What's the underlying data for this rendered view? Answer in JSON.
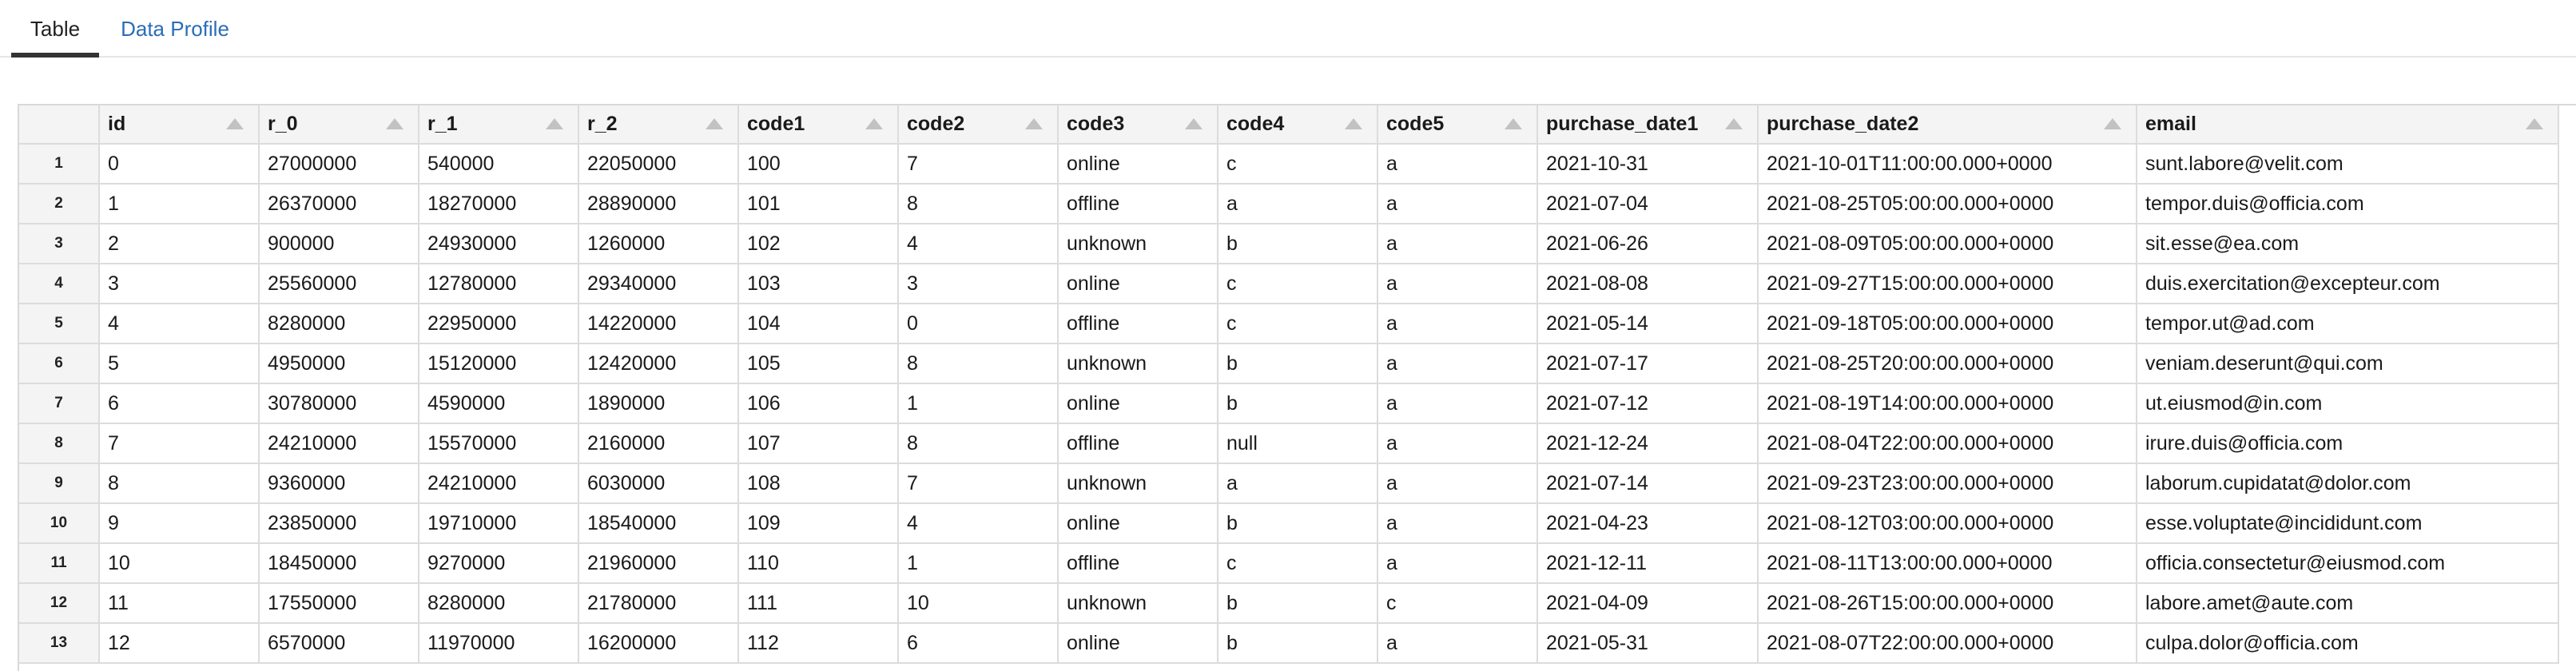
{
  "tabs": [
    {
      "label": "Table",
      "active": true
    },
    {
      "label": "Data Profile",
      "active": false
    }
  ],
  "table": {
    "columns": [
      "id",
      "r_0",
      "r_1",
      "r_2",
      "code1",
      "code2",
      "code3",
      "code4",
      "code5",
      "purchase_date1",
      "purchase_date2",
      "email"
    ],
    "rows": [
      {
        "n": "1",
        "cells": [
          "0",
          "27000000",
          "540000",
          "22050000",
          "100",
          "7",
          "online",
          "c",
          "a",
          "2021-10-31",
          "2021-10-01T11:00:00.000+0000",
          "sunt.labore@velit.com"
        ]
      },
      {
        "n": "2",
        "cells": [
          "1",
          "26370000",
          "18270000",
          "28890000",
          "101",
          "8",
          "offline",
          "a",
          "a",
          "2021-07-04",
          "2021-08-25T05:00:00.000+0000",
          "tempor.duis@officia.com"
        ]
      },
      {
        "n": "3",
        "cells": [
          "2",
          "900000",
          "24930000",
          "1260000",
          "102",
          "4",
          "unknown",
          "b",
          "a",
          "2021-06-26",
          "2021-08-09T05:00:00.000+0000",
          "sit.esse@ea.com"
        ]
      },
      {
        "n": "4",
        "cells": [
          "3",
          "25560000",
          "12780000",
          "29340000",
          "103",
          "3",
          "online",
          "c",
          "a",
          "2021-08-08",
          "2021-09-27T15:00:00.000+0000",
          "duis.exercitation@excepteur.com"
        ]
      },
      {
        "n": "5",
        "cells": [
          "4",
          "8280000",
          "22950000",
          "14220000",
          "104",
          "0",
          "offline",
          "c",
          "a",
          "2021-05-14",
          "2021-09-18T05:00:00.000+0000",
          "tempor.ut@ad.com"
        ]
      },
      {
        "n": "6",
        "cells": [
          "5",
          "4950000",
          "15120000",
          "12420000",
          "105",
          "8",
          "unknown",
          "b",
          "a",
          "2021-07-17",
          "2021-08-25T20:00:00.000+0000",
          "veniam.deserunt@qui.com"
        ]
      },
      {
        "n": "7",
        "cells": [
          "6",
          "30780000",
          "4590000",
          "1890000",
          "106",
          "1",
          "online",
          "b",
          "a",
          "2021-07-12",
          "2021-08-19T14:00:00.000+0000",
          "ut.eiusmod@in.com"
        ]
      },
      {
        "n": "8",
        "cells": [
          "7",
          "24210000",
          "15570000",
          "2160000",
          "107",
          "8",
          "offline",
          "null",
          "a",
          "2021-12-24",
          "2021-08-04T22:00:00.000+0000",
          "irure.duis@officia.com"
        ]
      },
      {
        "n": "9",
        "cells": [
          "8",
          "9360000",
          "24210000",
          "6030000",
          "108",
          "7",
          "unknown",
          "a",
          "a",
          "2021-07-14",
          "2021-09-23T23:00:00.000+0000",
          "laborum.cupidatat@dolor.com"
        ]
      },
      {
        "n": "10",
        "cells": [
          "9",
          "23850000",
          "19710000",
          "18540000",
          "109",
          "4",
          "online",
          "b",
          "a",
          "2021-04-23",
          "2021-08-12T03:00:00.000+0000",
          "esse.voluptate@incididunt.com"
        ]
      },
      {
        "n": "11",
        "cells": [
          "10",
          "18450000",
          "9270000",
          "21960000",
          "110",
          "1",
          "offline",
          "c",
          "a",
          "2021-12-11",
          "2021-08-11T13:00:00.000+0000",
          "officia.consectetur@eiusmod.com"
        ]
      },
      {
        "n": "12",
        "cells": [
          "11",
          "17550000",
          "8280000",
          "21780000",
          "111",
          "10",
          "unknown",
          "b",
          "c",
          "2021-04-09",
          "2021-08-26T15:00:00.000+0000",
          "labore.amet@aute.com"
        ]
      },
      {
        "n": "13",
        "cells": [
          "12",
          "6570000",
          "11970000",
          "16200000",
          "112",
          "6",
          "online",
          "b",
          "a",
          "2021-05-31",
          "2021-08-07T22:00:00.000+0000",
          "culpa.dolor@officia.com"
        ]
      }
    ]
  }
}
